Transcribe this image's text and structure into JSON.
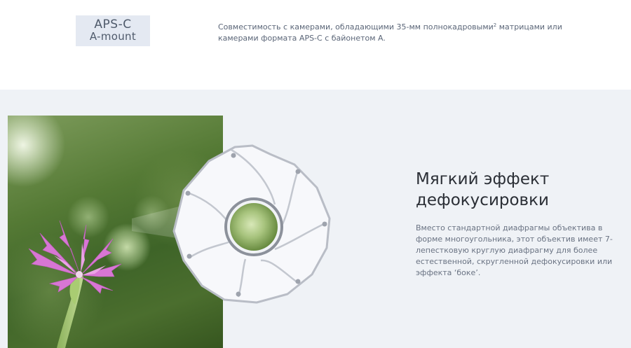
{
  "badge": {
    "line1": "APS-C",
    "line2": "A-mount"
  },
  "compatibility": {
    "text_before": "Совместимость с камерами, обладающими 35-мм полнокадровыми",
    "footnote": "2",
    "text_after": " матрицами или камерами формата APS-C с байонетом A."
  },
  "feature": {
    "title_line1": "Мягкий эффект",
    "title_line2": "дефокусировки",
    "description": "Вместо стандартной диафрагмы объектива в форме многоугольника, этот объектив имеет 7-лепестковую круглую диафрагму для более естественной, скругленной дефокусировки или эффекта ‘боке’.",
    "photo": "flower-bokeh-photo",
    "aperture_blades": 7
  },
  "colors": {
    "feature_bg": "#eff2f6",
    "badge_bg": "#e4e9f2",
    "blade_fill": "#f7f8fb",
    "blade_stroke": "#b9bdc6",
    "flower": "#d76fd2"
  }
}
